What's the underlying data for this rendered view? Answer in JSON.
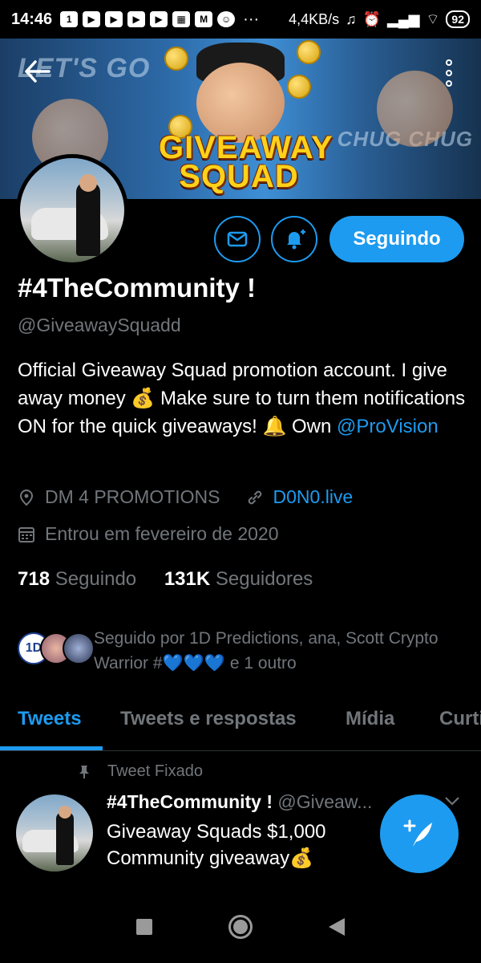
{
  "status_bar": {
    "time": "14:46",
    "network_speed": "4,4KB/s",
    "battery": "92",
    "notification_icons": [
      "screen-icon",
      "youtube-icon",
      "youtube-icon",
      "youtube-icon",
      "youtube-icon",
      "grid-icon",
      "gmail-icon",
      "emoji-icon"
    ],
    "overflow": "···"
  },
  "banner": {
    "title_line1": "GIVEAWAY",
    "title_line2": "SQUAD",
    "left_text": "LET'S GO",
    "right_text": "CHUG CHUG"
  },
  "profile": {
    "name": "#4TheCommunity !",
    "handle": "@GiveawaySquadd",
    "bio_part1": "Official Giveaway Squad promotion account. I give away money 💰 Make sure to turn them notifications ON for the quick giveaways! 🔔 Own ",
    "bio_link": "@ProVision",
    "location": "DM 4 PROMOTIONS",
    "website": "D0N0.live",
    "joined": "Entrou em fevereiro de 2020",
    "following_count": "718",
    "following_label": "Seguindo",
    "followers_count": "131K",
    "followers_label": "Seguidores",
    "follow_button": "Seguindo",
    "followed_by": "Seguido por 1D Predictions, ana, Scott Crypto Warrior #💙💙💙 e 1 outro",
    "followed_avatar_label": "1D"
  },
  "tabs": [
    {
      "label": "Tweets",
      "active": true
    },
    {
      "label": "Tweets e respostas",
      "active": false
    },
    {
      "label": "Mídia",
      "active": false
    },
    {
      "label": "Curtidas",
      "active": false
    }
  ],
  "pinned_tweet": {
    "pinned_label": "Tweet Fixado",
    "author_name": "#4TheCommunity !",
    "author_handle": "@Giveaw...",
    "text": "Giveaway Squads $1,000 Community giveaway💰"
  },
  "colors": {
    "accent": "#1d9bf0",
    "background": "#000000",
    "secondary_text": "#71767b"
  }
}
